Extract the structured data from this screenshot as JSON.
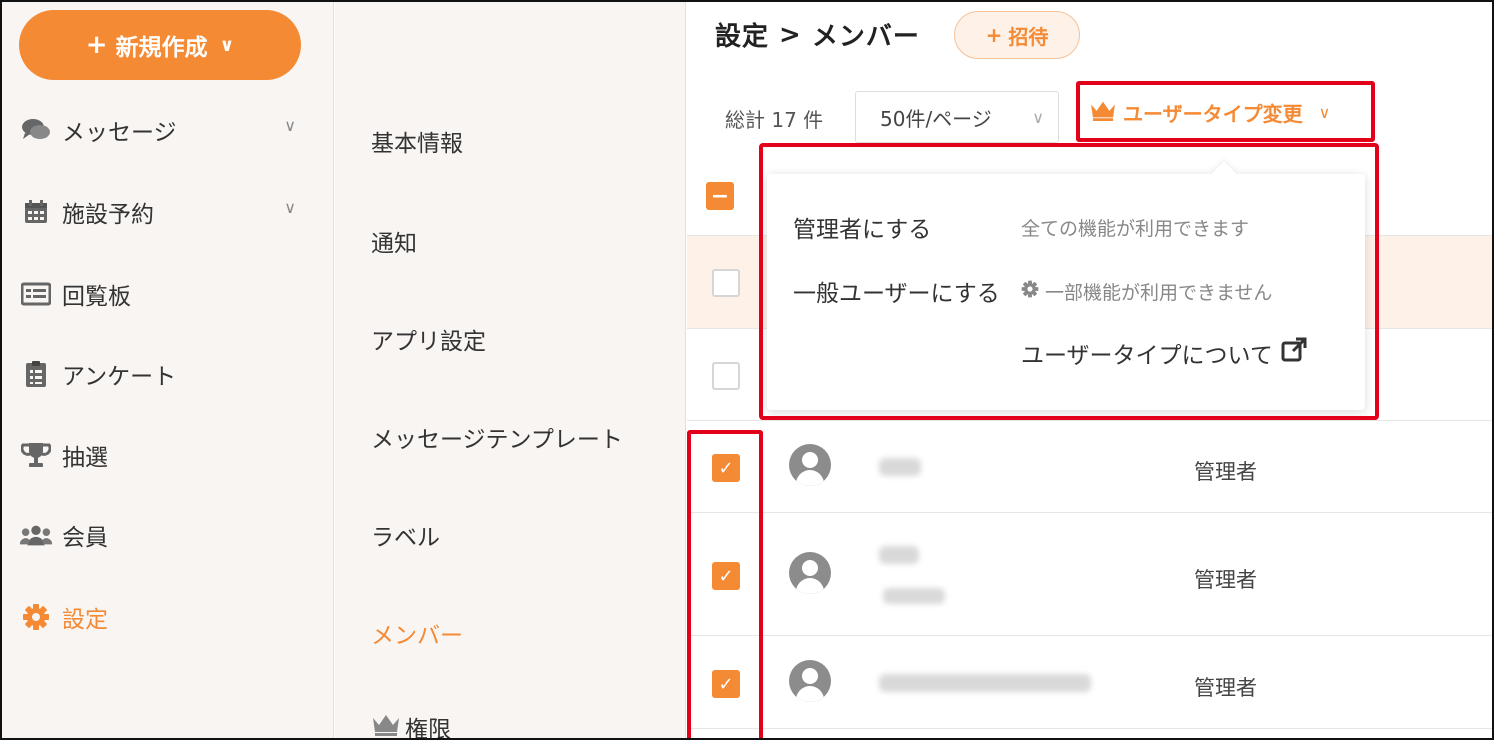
{
  "nav": {
    "new_button": "新規作成",
    "items": [
      {
        "label": "メッセージ",
        "icon": "chat-icon",
        "expandable": true
      },
      {
        "label": "施設予約",
        "icon": "calendar-icon",
        "expandable": true
      },
      {
        "label": "回覧板",
        "icon": "board-icon",
        "expandable": false
      },
      {
        "label": "アンケート",
        "icon": "clipboard-icon",
        "expandable": false
      },
      {
        "label": "抽選",
        "icon": "trophy-icon",
        "expandable": false
      },
      {
        "label": "会員",
        "icon": "users-icon",
        "expandable": false
      },
      {
        "label": "設定",
        "icon": "gear-icon",
        "expandable": false,
        "active": true
      }
    ]
  },
  "settings_menu": {
    "items": [
      {
        "label": "基本情報"
      },
      {
        "label": "通知"
      },
      {
        "label": "アプリ設定"
      },
      {
        "label": "メッセージテンプレート"
      },
      {
        "label": "ラベル"
      },
      {
        "label": "メンバー",
        "active": true
      },
      {
        "label": "権限",
        "icon": "crown-icon"
      }
    ]
  },
  "header": {
    "breadcrumb_parent": "設定",
    "breadcrumb_separator": ">",
    "breadcrumb_current": "メンバー",
    "invite_label": "招待"
  },
  "toolbar": {
    "total": "総計 17 件",
    "per_page": "50件/ページ",
    "user_type_change": "ユーザータイプ変更"
  },
  "dropdown": {
    "options": [
      {
        "label": "管理者にする",
        "description": "全ての機能が利用できます"
      },
      {
        "label": "一般ユーザーにする",
        "description": "一部機能が利用できません"
      }
    ],
    "help_link": "ユーザータイプについて"
  },
  "members": [
    {
      "checked": false,
      "role": ""
    },
    {
      "checked": false,
      "role": ""
    },
    {
      "checked": true,
      "role": "管理者"
    },
    {
      "checked": true,
      "role": "管理者"
    },
    {
      "checked": true,
      "role": "管理者"
    }
  ],
  "colors": {
    "accent": "#f58a35",
    "highlight_box": "#e3001b",
    "sidebar_bg": "#f8f5f3",
    "selected_row_bg": "#fdf1e8"
  }
}
